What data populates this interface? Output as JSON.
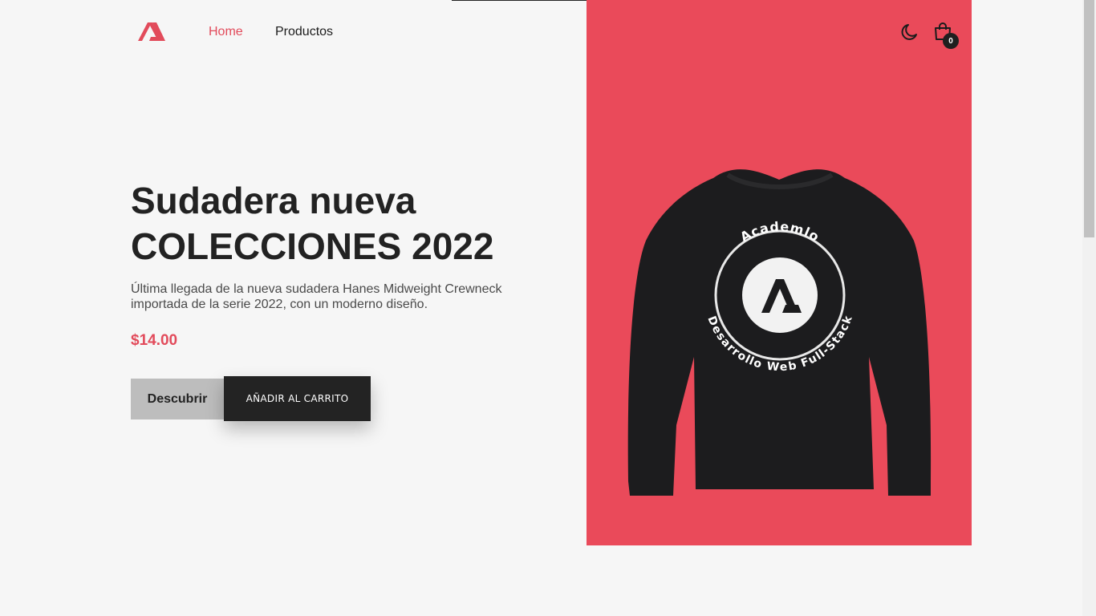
{
  "nav": {
    "logo_icon": "academlo-logo-icon",
    "links": [
      "Home",
      "Productos"
    ],
    "active_link": "Home",
    "cart_count": "0"
  },
  "hero": {
    "title_line1": "Sudadera nueva",
    "title_line2": "COLECCIONES 2022",
    "description": "Última llegada de la nueva sudadera Hanes Midweight Crewneck importada de la serie 2022, con un moderno diseño.",
    "price": "$14.00",
    "discover_label": "Descubrir",
    "add_to_cart_label": "AÑADIR AL CARRITO",
    "image_bg": "#ea4a5a",
    "print_top": "Academlo",
    "print_bottom": "Desarrollo Web Full-Stack"
  },
  "colors": {
    "accent": "#e24b5b",
    "dark": "#232323",
    "background": "#f6f6f6"
  }
}
